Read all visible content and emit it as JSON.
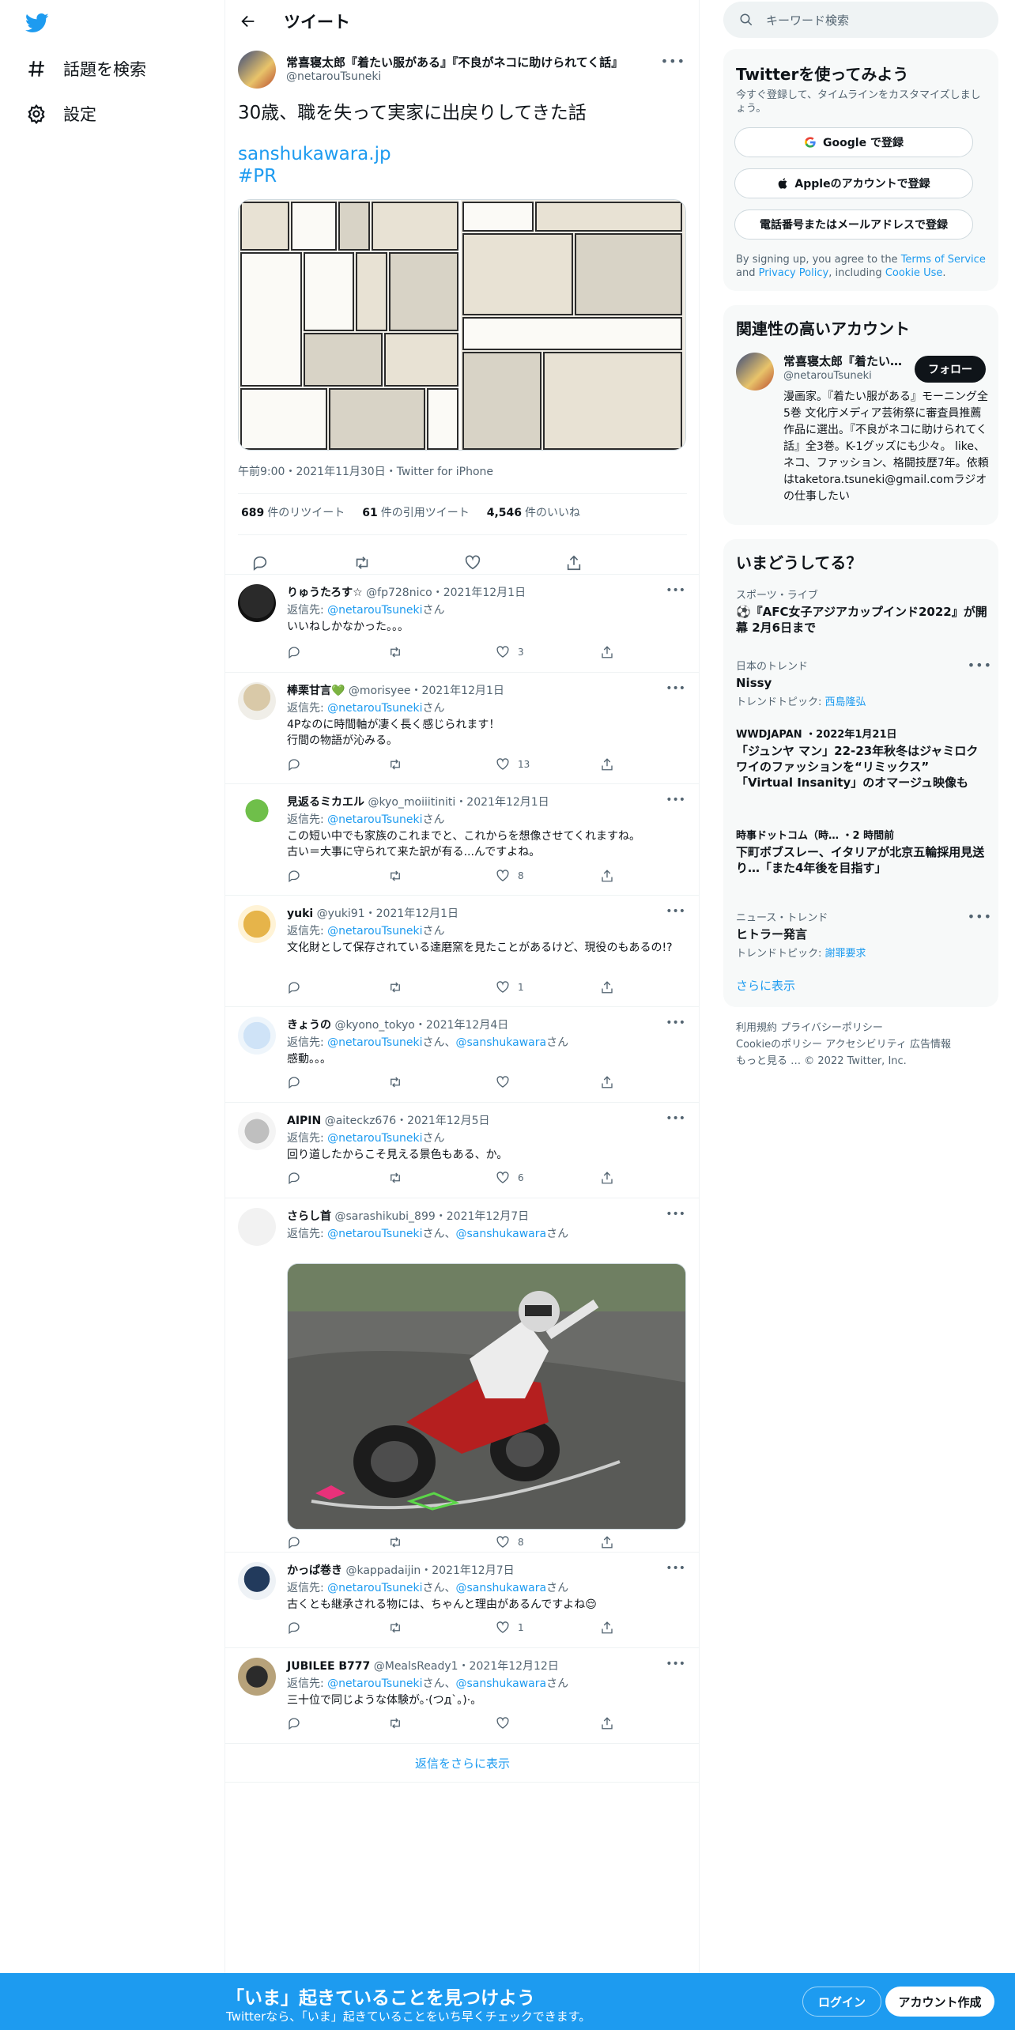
{
  "nav": {
    "items": [
      {
        "label": "話題を検索",
        "icon": "hashtag-icon"
      },
      {
        "label": "設定",
        "icon": "gear-icon"
      }
    ]
  },
  "header": {
    "title": "ツイート"
  },
  "main_tweet": {
    "name": "常喜寝太郎『着たい服がある』『不良がネコに助けられてく話』",
    "handle": "@netarouTsuneki",
    "text": "30歳、職を失って実家に出戻りしてきた話",
    "link": "sanshukawara.jp",
    "hashtag": "#PR",
    "meta": "午前9:00・2021年11月30日・Twitter for iPhone",
    "stats": [
      {
        "num": "689",
        "label": "件のリツイート"
      },
      {
        "num": "61",
        "label": "件の引用ツイート"
      },
      {
        "num": "4,546",
        "label": "件のいいね"
      }
    ]
  },
  "replies": [
    {
      "name": "りゅうたろす☆",
      "handle": "@fp728nico",
      "date": "・2021年12月1日",
      "to_prefix": "返信先: ",
      "to": "@netarouTsuneki",
      "to_suffix": "さん",
      "text": "いいねしかなかった。。。",
      "likes": "3"
    },
    {
      "name": "棒栗甘言💚",
      "handle": "@morisyee",
      "date": "・2021年12月1日",
      "to_prefix": "返信先: ",
      "to": "@netarouTsuneki",
      "to_suffix": "さん",
      "text": "4Pなのに時間軸が凄く長く感じられます！\n行間の物語が沁みる。",
      "likes": "13"
    },
    {
      "name": "見返るミカエル",
      "handle": "@kyo_moiiitiniti",
      "date": "・2021年12月1日",
      "to_prefix": "返信先: ",
      "to": "@netarouTsuneki",
      "to_suffix": "さん",
      "text": "この短い中でも家族のこれまでと、これからを想像させてくれますね。\n古い＝大事に守られて来た訳が有る...んですよね。",
      "likes": "8"
    },
    {
      "name": "yuki",
      "handle": "@yuki91",
      "date": "・2021年12月1日",
      "to_prefix": "返信先: ",
      "to": "@netarouTsuneki",
      "to_suffix": "さん",
      "text": "文化財として保存されている達磨窯を見たことがあるけど、現役のもあるの!?",
      "likes": "1"
    },
    {
      "name": "きょうの",
      "handle": "@kyono_tokyo",
      "date": "・2021年12月4日",
      "to_prefix": "返信先: ",
      "to": "@netarouTsuneki",
      "to_mid": "さん、",
      "to2": "@sanshukawara",
      "to_suffix": "さん",
      "text": "感動。。。",
      "likes": ""
    },
    {
      "name": "AIPIN",
      "handle": "@aiteckz676",
      "date": "・2021年12月5日",
      "to_prefix": "返信先: ",
      "to": "@netarouTsuneki",
      "to_suffix": "さん",
      "text": "回り道したからこそ見える景色もある、か。",
      "likes": "6"
    },
    {
      "name": "さらし首",
      "handle": "@sarashikubi_899",
      "date": "・2021年12月7日",
      "to_prefix": "返信先: ",
      "to": "@netarouTsuneki",
      "to_mid": "さん、",
      "to2": "@sanshukawara",
      "to_suffix": "さん",
      "text": "",
      "likes": "8"
    },
    {
      "name": "かっぱ巻き",
      "handle": "@kappadaijin",
      "date": "・2021年12月7日",
      "to_prefix": "返信先: ",
      "to": "@netarouTsuneki",
      "to_mid": "さん、",
      "to2": "@sanshukawara",
      "to_suffix": "さん",
      "text": "古くとも継承される物には、ちゃんと理由があるんですよね😌",
      "likes": "1"
    },
    {
      "name": "JUBILEE B777",
      "handle": "@MealsReady1",
      "date": "・2021年12月12日",
      "to_prefix": "返信先: ",
      "to": "@netarouTsuneki",
      "to_mid": "さん、",
      "to2": "@sanshukawara",
      "to_suffix": "さん",
      "text": "三十位で同じような体験が。·(つд`｡)·。",
      "likes": ""
    }
  ],
  "show_more_replies": "返信をさらに表示",
  "right": {
    "search_placeholder": "キーワード検索",
    "signup": {
      "title": "Twitterを使ってみよう",
      "subtitle": "今すぐ登録して、タイムラインをカスタマイズしましょう。",
      "google": "Google で登録",
      "apple": "Appleのアカウントで登録",
      "phone": "電話番号またはメールアドレスで登録",
      "terms_1": "By signing up, you agree to the ",
      "terms_link1": "Terms of Service",
      "terms_2": " and ",
      "terms_link2": "Privacy Policy",
      "terms_3": ", including ",
      "terms_link3": "Cookie Use",
      "terms_4": "."
    },
    "relevant": {
      "title": "関連性の高いアカウント",
      "name": "常喜寝太郎『着たい…",
      "handle": "@netarouTsuneki",
      "follow": "フォロー",
      "bio": "漫画家。『着たい服がある』モーニング全5巻 文化庁メディア芸術祭に審査員推薦作品に選出。『不良がネコに助けられてく話』全3巻。K-1グッズにも少々。 like、ネコ、ファッション、格闘技歴7年。依頼はtaketora.tsuneki@gmail.comラジオの仕事したい"
    },
    "trends": {
      "title": "いまどうしてる？",
      "items": [
        {
          "cat": "スポーツ・ライブ",
          "title": "⚽️『AFC女子アジアカップインド2022』が開幕 2月6日まで",
          "topic_prefix": "",
          "topic": ""
        },
        {
          "cat": "日本のトレンド",
          "title": "Nissy",
          "topic_prefix": "トレンドトピック: ",
          "topic": "西島隆弘"
        },
        {
          "cat": "WWDJAPAN ・2022年1月21日",
          "title": "「ジュンヤ マン」22-23年秋冬はジャミロクワイのファッションを“リミックス” 「Virtual Insanity」のオマージュ映像も",
          "topic_prefix": "",
          "topic": ""
        },
        {
          "cat": "時事ドットコム（時… ・2 時間前",
          "title": "下町ボブスレー、イタリアが北京五輪採用見送り…「また4年後を目指す」",
          "topic_prefix": "",
          "topic": ""
        },
        {
          "cat": "ニュース・トレンド",
          "title": "ヒトラー発言",
          "topic_prefix": "トレンドトピック: ",
          "topic": "謝罪要求"
        }
      ],
      "show_more": "さらに表示"
    },
    "footer": {
      "line1": "利用規約   プライバシーポリシー",
      "line2": "Cookieのポリシー   アクセシビリティ   広告情報",
      "line3": "もっと見る …   © 2022 Twitter, Inc."
    }
  },
  "bottom": {
    "title": "「いま」起きていることを見つけよう",
    "subtitle": "Twitterなら、「いま」起きていることをいち早くチェックできます。",
    "login": "ログイン",
    "signup": "アカウント作成"
  },
  "colors": {
    "accent": "#1d9bf0",
    "text": "#0f1419",
    "muted": "#536471",
    "border": "#eff3f4"
  }
}
